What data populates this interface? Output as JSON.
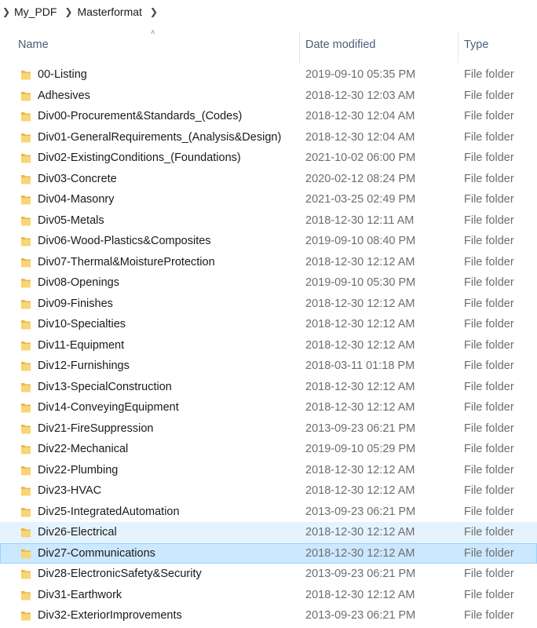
{
  "breadcrumb": {
    "items": [
      "My_PDF",
      "Masterformat"
    ]
  },
  "columns": {
    "name": "Name",
    "date": "Date modified",
    "type": "Type"
  },
  "folder_color": "#f8d575",
  "rows": [
    {
      "name": "00-Listing",
      "date": "2019-09-10 05:35 PM",
      "type": "File folder",
      "state": ""
    },
    {
      "name": "Adhesives",
      "date": "2018-12-30 12:03 AM",
      "type": "File folder",
      "state": ""
    },
    {
      "name": "Div00-Procurement&Standards_(Codes)",
      "date": "2018-12-30 12:04 AM",
      "type": "File folder",
      "state": ""
    },
    {
      "name": "Div01-GeneralRequirements_(Analysis&Design)",
      "date": "2018-12-30 12:04 AM",
      "type": "File folder",
      "state": ""
    },
    {
      "name": "Div02-ExistingConditions_(Foundations)",
      "date": "2021-10-02 06:00 PM",
      "type": "File folder",
      "state": ""
    },
    {
      "name": "Div03-Concrete",
      "date": "2020-02-12 08:24 PM",
      "type": "File folder",
      "state": ""
    },
    {
      "name": "Div04-Masonry",
      "date": "2021-03-25 02:49 PM",
      "type": "File folder",
      "state": ""
    },
    {
      "name": "Div05-Metals",
      "date": "2018-12-30 12:11 AM",
      "type": "File folder",
      "state": ""
    },
    {
      "name": "Div06-Wood-Plastics&Composites",
      "date": "2019-09-10 08:40 PM",
      "type": "File folder",
      "state": ""
    },
    {
      "name": "Div07-Thermal&MoistureProtection",
      "date": "2018-12-30 12:12 AM",
      "type": "File folder",
      "state": ""
    },
    {
      "name": "Div08-Openings",
      "date": "2019-09-10 05:30 PM",
      "type": "File folder",
      "state": ""
    },
    {
      "name": "Div09-Finishes",
      "date": "2018-12-30 12:12 AM",
      "type": "File folder",
      "state": ""
    },
    {
      "name": "Div10-Specialties",
      "date": "2018-12-30 12:12 AM",
      "type": "File folder",
      "state": ""
    },
    {
      "name": "Div11-Equipment",
      "date": "2018-12-30 12:12 AM",
      "type": "File folder",
      "state": ""
    },
    {
      "name": "Div12-Furnishings",
      "date": "2018-03-11 01:18 PM",
      "type": "File folder",
      "state": ""
    },
    {
      "name": "Div13-SpecialConstruction",
      "date": "2018-12-30 12:12 AM",
      "type": "File folder",
      "state": ""
    },
    {
      "name": "Div14-ConveyingEquipment",
      "date": "2018-12-30 12:12 AM",
      "type": "File folder",
      "state": ""
    },
    {
      "name": "Div21-FireSuppression",
      "date": "2013-09-23 06:21 PM",
      "type": "File folder",
      "state": ""
    },
    {
      "name": "Div22-Mechanical",
      "date": "2019-09-10 05:29 PM",
      "type": "File folder",
      "state": ""
    },
    {
      "name": "Div22-Plumbing",
      "date": "2018-12-30 12:12 AM",
      "type": "File folder",
      "state": ""
    },
    {
      "name": "Div23-HVAC",
      "date": "2018-12-30 12:12 AM",
      "type": "File folder",
      "state": ""
    },
    {
      "name": "Div25-IntegratedAutomation",
      "date": "2013-09-23 06:21 PM",
      "type": "File folder",
      "state": ""
    },
    {
      "name": "Div26-Electrical",
      "date": "2018-12-30 12:12 AM",
      "type": "File folder",
      "state": "hover"
    },
    {
      "name": "Div27-Communications",
      "date": "2018-12-30 12:12 AM",
      "type": "File folder",
      "state": "selected"
    },
    {
      "name": "Div28-ElectronicSafety&Security",
      "date": "2013-09-23 06:21 PM",
      "type": "File folder",
      "state": ""
    },
    {
      "name": "Div31-Earthwork",
      "date": "2018-12-30 12:12 AM",
      "type": "File folder",
      "state": ""
    },
    {
      "name": "Div32-ExteriorImprovements",
      "date": "2013-09-23 06:21 PM",
      "type": "File folder",
      "state": ""
    }
  ]
}
